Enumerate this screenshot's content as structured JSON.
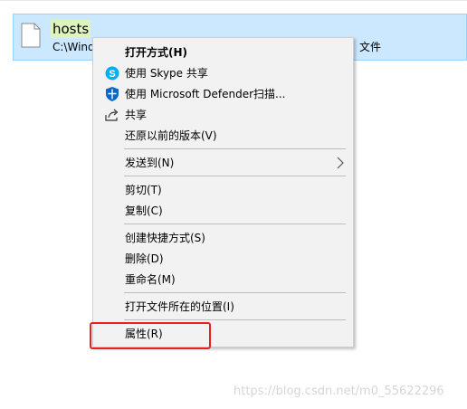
{
  "file": {
    "name": "hosts",
    "path": "C:\\Wind",
    "type_suffix": "文件"
  },
  "menu": {
    "items": [
      {
        "label": "打开方式(H)",
        "icon": "none"
      },
      {
        "label": "使用 Skype 共享",
        "icon": "skype-icon"
      },
      {
        "label": "使用 Microsoft Defender扫描...",
        "icon": "defender-shield-icon"
      },
      {
        "label": "共享",
        "icon": "share-icon"
      },
      {
        "label": "还原以前的版本(V)",
        "icon": "none"
      },
      {
        "label": "发送到(N)",
        "icon": "chevron-right-icon"
      },
      {
        "label": "剪切(T)",
        "icon": "none"
      },
      {
        "label": "复制(C)",
        "icon": "none"
      },
      {
        "label": "创建快捷方式(S)",
        "icon": "none"
      },
      {
        "label": "删除(D)",
        "icon": "none"
      },
      {
        "label": "重命名(M)",
        "icon": "none"
      },
      {
        "label": "打开文件所在的位置(I)",
        "icon": "none"
      },
      {
        "label": "属性(R)",
        "icon": "none"
      }
    ]
  },
  "annotation": {
    "color": "#e8221b",
    "target": "属性(R)"
  },
  "watermark": "https://blog.csdn.net/m0_55622296",
  "colors": {
    "selection": "#cce8ff",
    "menu_bg": "#f2f2f2",
    "name_highlight": "#dff4bd"
  }
}
